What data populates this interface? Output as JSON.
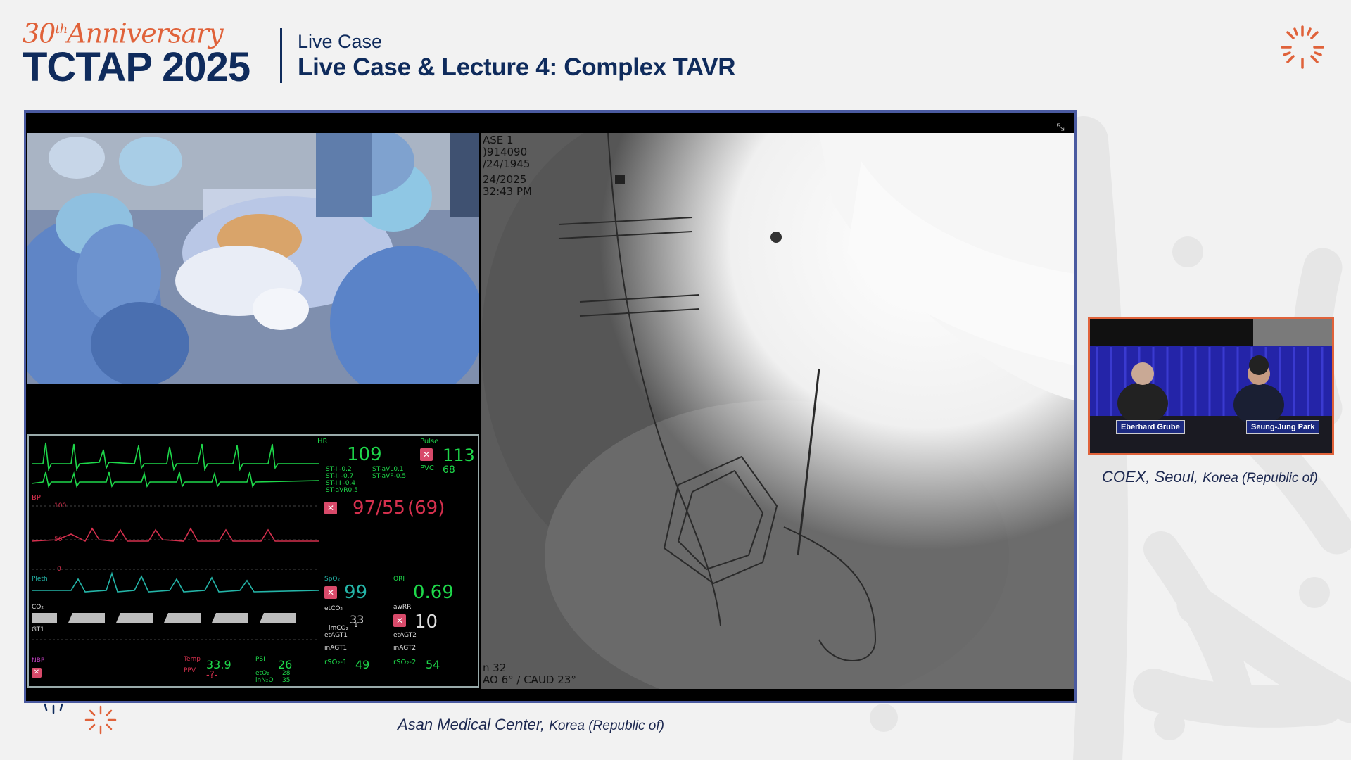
{
  "header": {
    "anniversary_number": "30",
    "anniversary_suffix": "th",
    "anniversary_word": "Anniversary",
    "brand": "TCTAP 2025",
    "session_kind": "Live Case",
    "session_title": "Live Case & Lecture 4: Complex TAVR"
  },
  "colors": {
    "navy": "#0f2b5c",
    "orange": "#e0623a",
    "frame_border": "#4a5aa0"
  },
  "icons": {
    "logo_mark": "burst-icon",
    "expand": "collapse-arrows-icon"
  },
  "main_feed": {
    "xray_overlay": {
      "case": "ASE 1",
      "patient_id": ")914090",
      "dob": "/24/1945",
      "date": "24/2025",
      "time": "32:43 PM",
      "frame": "n 32",
      "angle": "AO 6° / CAUD 23°"
    },
    "monitor": {
      "hr_label": "HR",
      "hr_value": "109",
      "pulse_label": "Pulse",
      "pulse_value": "113",
      "pvc_label": "PVC",
      "pvc_value": "68",
      "st_labels": [
        "ST-I  -0.2",
        "ST-II  -0.7",
        "ST-III  -0.4",
        "ST-aVR0.5"
      ],
      "st_labels_right": [
        "ST-aVL0.1",
        "ST-aVF-0.5"
      ],
      "bp_value": "97/55",
      "bp_mean": "(69)",
      "art_label": "BP",
      "scale_100": "100",
      "scale_50": "50",
      "scale_0": "0",
      "pleth_label": "Pleth",
      "spo2_label": "SpO₂",
      "spo2_value": "99",
      "pi_label": "ORI",
      "pi_value": "0.69",
      "co2_label": "CO₂",
      "etco2_label": "etCO₂",
      "etco2_value": "33",
      "awrr_label": "awRR",
      "awrr_value": "10",
      "imco2_label": "imCO₂",
      "imco2_value": "1",
      "gt1_label": "GT1",
      "etagt1": "etAGT1",
      "inagt1": "inAGT1",
      "etagt2": "etAGT2",
      "inagt2": "inAGT2",
      "temp_label": "Temp",
      "temp_value": "33.9",
      "psi_label": "PSI",
      "psi_value": "26",
      "rso2_1_label": "rSO₂-1",
      "rso2_1_value": "49",
      "rso2_2_label": "rSO₂-2",
      "rso2_2_value": "54",
      "nbp_label": "NBP",
      "ppv_label": "PPV",
      "ppv_value": "-?-",
      "eto2_label": "etO₂",
      "eto2_value": "28",
      "inn2o_label": "inN₂O",
      "inn2o_value": "35"
    }
  },
  "caption_main": {
    "venue": "Asan Medical Center,",
    "country": "Korea (Republic of)"
  },
  "pip": {
    "panelist_left": "Eberhard Grube",
    "panelist_right": "Seung-Jung Park",
    "caption_venue": "COEX, Seoul,",
    "caption_country": "Korea (Republic of)"
  }
}
